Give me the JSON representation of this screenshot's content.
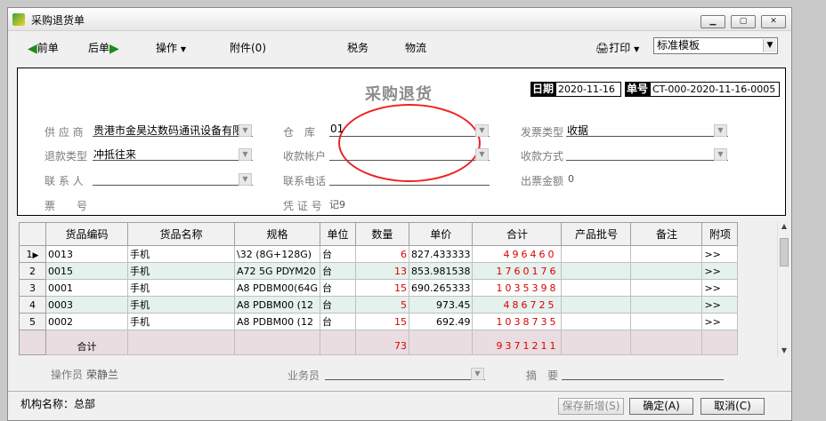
{
  "window": {
    "title": "采购退货单"
  },
  "toolbar": {
    "prev": "前单",
    "next": "后单",
    "operate": "操作",
    "attachment": "附件(0)",
    "tax": "税务",
    "logistics": "物流",
    "print": "打印",
    "template": "标准模板"
  },
  "doc": {
    "title": "采购退货",
    "date_label": "日期",
    "date": "2020-11-16",
    "number_label": "单号",
    "number": "CT-000-2020-11-16-0005"
  },
  "fields": {
    "supplier_label": "供 应 商",
    "supplier": "贵港市金昊达数码通讯设备有限",
    "warehouse_label": "仓　库",
    "warehouse": "01",
    "invoice_type_label": "发票类型",
    "invoice_type": "收据",
    "refund_type_label": "退款类型",
    "refund_type": "冲抵往来",
    "account_label": "收款帐户",
    "account": "",
    "payment_method_label": "收款方式",
    "payment_method": "",
    "contact_label": "联 系 人",
    "contact": "",
    "phone_label": "联系电话",
    "phone": "",
    "invoice_amount_label": "出票金额",
    "invoice_amount": "0",
    "ticket_label": "票　　号",
    "ticket": "",
    "voucher_label": "凭 证 号",
    "voucher": "记9"
  },
  "table": {
    "columns": [
      "货品编码",
      "货品名称",
      "规格",
      "单位",
      "数量",
      "单价",
      "合计",
      "产品批号",
      "备注",
      "附项"
    ],
    "rows": [
      {
        "no": "1",
        "code": "0013",
        "name": "手机",
        "spec": "\\32 (8G+128G)",
        "unit": "台",
        "qty": "6",
        "price": "827.433333",
        "total": "496460",
        "batch": "",
        "note": "",
        "extra": ">>"
      },
      {
        "no": "2",
        "code": "0015",
        "name": "手机",
        "spec": "A72 5G PDYM20",
        "unit": "台",
        "qty": "13",
        "price": "853.981538",
        "total": "1760176",
        "batch": "",
        "note": "",
        "extra": ">>"
      },
      {
        "no": "3",
        "code": "0001",
        "name": "手机",
        "spec": "A8 PDBM00(64G",
        "unit": "台",
        "qty": "15",
        "price": "690.265333",
        "total": "1035398",
        "batch": "",
        "note": "",
        "extra": ">>"
      },
      {
        "no": "4",
        "code": "0003",
        "name": "手机",
        "spec": "A8 PDBM00 (12",
        "unit": "台",
        "qty": "5",
        "price": "973.45",
        "total": "486725",
        "batch": "",
        "note": "",
        "extra": ">>"
      },
      {
        "no": "5",
        "code": "0002",
        "name": "手机",
        "spec": "A8 PDBM00 (12",
        "unit": "台",
        "qty": "15",
        "price": "692.49",
        "total": "1038735",
        "batch": "",
        "note": "",
        "extra": ">>"
      }
    ],
    "total_label": "合计",
    "total_qty": "73",
    "total_amount": "9371211"
  },
  "footer": {
    "operator_label": "操作员",
    "operator": "荣静兰",
    "salesman_label": "业务员",
    "salesman": "",
    "summary_label": "摘　要",
    "summary": "",
    "org": "机构名称：总部",
    "save_new": "保存新增(S)",
    "confirm": "确定(A)",
    "cancel": "取消(C)"
  }
}
